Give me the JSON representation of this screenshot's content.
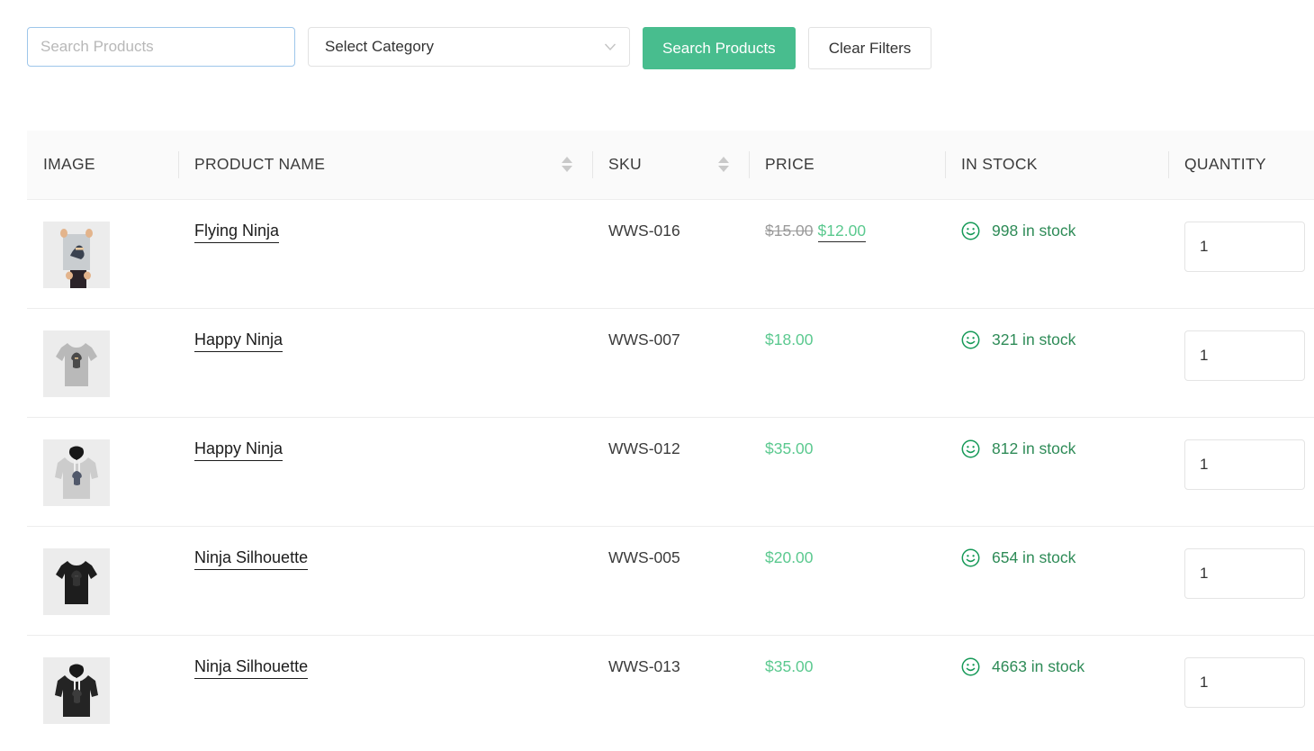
{
  "filter_bar": {
    "search_placeholder": "Search Products",
    "search_value": "",
    "category_selected": "Select Category",
    "category_icon": "chevron-down-icon",
    "search_button_label": "Search Products",
    "clear_button_label": "Clear Filters"
  },
  "colors": {
    "primary_green": "#48bd8e",
    "price_green": "#5bc98f",
    "stock_green": "#2e8b57",
    "focus_blue": "#9ec6ea",
    "header_bg": "#fafafa",
    "border": "#ededed"
  },
  "table": {
    "columns": [
      {
        "key": "image",
        "label": "IMAGE",
        "sortable": false
      },
      {
        "key": "name",
        "label": "PRODUCT NAME",
        "sortable": true
      },
      {
        "key": "sku",
        "label": "SKU",
        "sortable": true
      },
      {
        "key": "price",
        "label": "PRICE",
        "sortable": false
      },
      {
        "key": "in_stock",
        "label": "IN STOCK",
        "sortable": false
      },
      {
        "key": "quantity",
        "label": "QUANTITY",
        "sortable": false
      }
    ],
    "sort_icon": "sort-updown-icon",
    "stock_icon": "smiley-face-icon",
    "rows": [
      {
        "image_alt": "Flying Ninja poster held by person",
        "image_type": "poster",
        "name": "Flying Ninja",
        "sku": "WWS-016",
        "price_regular": "$15.00",
        "price_sale": "$12.00",
        "on_sale": true,
        "in_stock": "998 in stock",
        "quantity": "1"
      },
      {
        "image_alt": "Happy Ninja grey t-shirt",
        "image_type": "tshirt-light",
        "name": "Happy Ninja",
        "sku": "WWS-007",
        "price_regular": "",
        "price_sale": "$18.00",
        "on_sale": false,
        "in_stock": "321 in stock",
        "quantity": "1"
      },
      {
        "image_alt": "Happy Ninja grey hoodie",
        "image_type": "hoodie-light",
        "name": "Happy Ninja",
        "sku": "WWS-012",
        "price_regular": "",
        "price_sale": "$35.00",
        "on_sale": false,
        "in_stock": "812 in stock",
        "quantity": "1"
      },
      {
        "image_alt": "Ninja Silhouette black t-shirt",
        "image_type": "tshirt-dark",
        "name": "Ninja Silhouette",
        "sku": "WWS-005",
        "price_regular": "",
        "price_sale": "$20.00",
        "on_sale": false,
        "in_stock": "654 in stock",
        "quantity": "1"
      },
      {
        "image_alt": "Ninja Silhouette black hoodie",
        "image_type": "hoodie-dark",
        "name": "Ninja Silhouette",
        "sku": "WWS-013",
        "price_regular": "",
        "price_sale": "$35.00",
        "on_sale": false,
        "in_stock": "4663 in stock",
        "quantity": "1"
      }
    ]
  }
}
